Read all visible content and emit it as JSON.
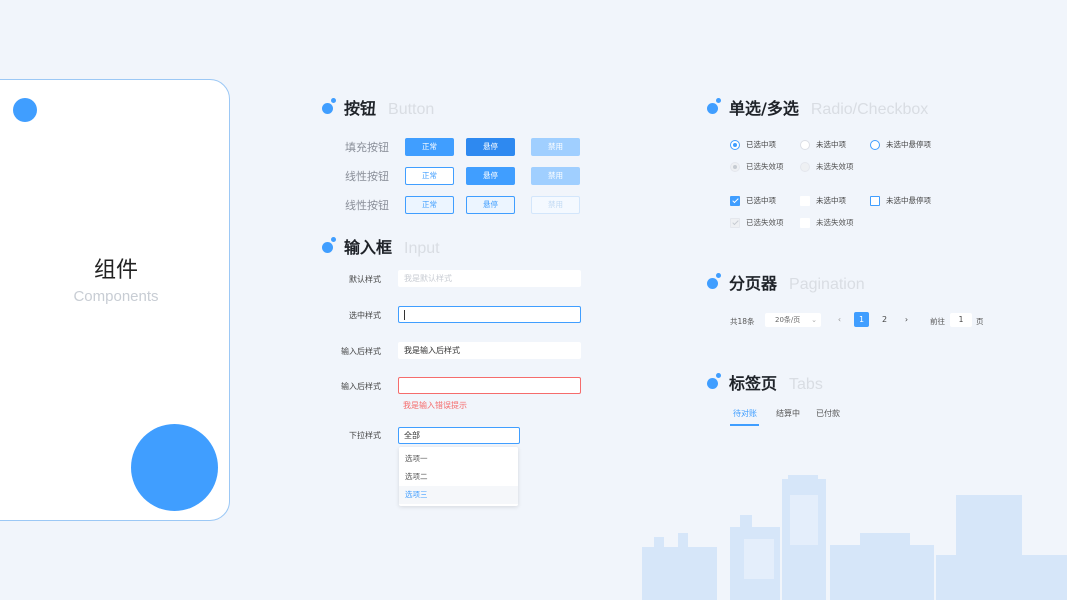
{
  "card": {
    "title": "组件",
    "subtitle": "Components"
  },
  "buttons": {
    "title_zh": "按钮",
    "title_en": "Button",
    "rows": [
      {
        "label": "填充按钮",
        "normal": "正常",
        "hover": "悬停",
        "disabled": "禁用"
      },
      {
        "label": "线性按钮",
        "normal": "正常",
        "hover": "悬停",
        "disabled": "禁用"
      },
      {
        "label": "线性按钮",
        "normal": "正常",
        "hover": "悬停",
        "disabled": "禁用"
      }
    ]
  },
  "input": {
    "title_zh": "输入框",
    "title_en": "Input",
    "default_label": "默认样式",
    "default_placeholder": "我是默认样式",
    "focus_label": "选中样式",
    "filled_label": "输入后样式",
    "filled_value": "我是输入后样式",
    "error_label": "输入后样式",
    "error_message": "我是输入错误提示",
    "dropdown_label": "下拉样式",
    "dropdown_value": "全部",
    "dropdown_options": [
      "选项一",
      "选项二",
      "选项三"
    ]
  },
  "radio": {
    "title_zh": "单选/多选",
    "title_en": "Radio/Checkbox",
    "radio_items": [
      "已选中项",
      "未选中项",
      "未选中悬停项",
      "已选失效项",
      "未选失效项"
    ],
    "checkbox_items": [
      "已选中项",
      "未选中项",
      "未选中悬停项",
      "已选失效项",
      "未选失效项"
    ]
  },
  "pagination": {
    "title_zh": "分页器",
    "title_en": "Pagination",
    "total": "共18条",
    "page_size": "20条/页",
    "prev": "‹",
    "pages": [
      "1",
      "2"
    ],
    "next": "›",
    "goto": "前往",
    "goto_value": "1",
    "page_unit": "页"
  },
  "tabs": {
    "title_zh": "标签页",
    "title_en": "Tabs",
    "items": [
      "待对账",
      "结算中",
      "已付款"
    ]
  },
  "colors": {
    "accent": "#409eff",
    "error": "#f56c6c",
    "background": "#f1f5fb"
  }
}
